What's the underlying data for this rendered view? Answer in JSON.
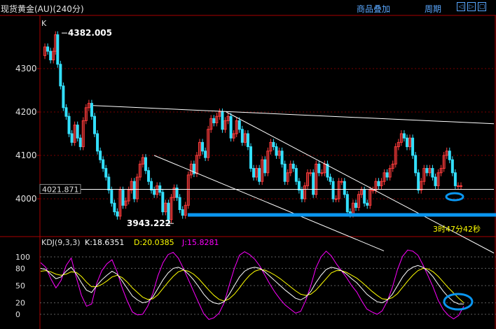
{
  "header": {
    "title": "现货黄金(AU)(240分)",
    "overlay_label": "商品叠加",
    "period_label": "周期",
    "buttons": [
      "◁",
      "▷",
      "▢"
    ]
  },
  "price_panel": {
    "indicator_label": "K",
    "y_ticks": [
      "4300",
      "4200",
      "4100",
      "4000"
    ],
    "current_price_label": "4021.871",
    "high_label": "4382.005",
    "low_label": "3943.222",
    "countdown_label": "3时47分42秒"
  },
  "kdj_panel": {
    "label": "KDJ(9,3,3)",
    "k_label": "K:18.6351",
    "d_label": "D:20.0385",
    "j_label": "J:15.8281",
    "y_ticks": [
      "100",
      "80",
      "50",
      "20",
      "0"
    ]
  },
  "colors": {
    "background": "#000000",
    "up": "#ff3c3c",
    "down": "#33e0ff",
    "grid_price": "#7a0000",
    "grid_kdj": "#606060",
    "k_line": "#ffffff",
    "d_line": "#ffff00",
    "j_line": "#ff00ff",
    "highlight": "#0a96f0"
  },
  "chart_data": {
    "type": "candlestick",
    "ylim": [
      3920,
      4460
    ],
    "y_ticks": [
      4300,
      4200,
      4100,
      4000
    ],
    "high": 4382.005,
    "low": 3943.222,
    "current": 4021.871,
    "path": [
      [
        0,
        4330
      ],
      [
        4,
        4350
      ],
      [
        8,
        4340
      ],
      [
        12,
        4320
      ],
      [
        16,
        4340
      ],
      [
        19,
        4378
      ],
      [
        22,
        4310
      ],
      [
        26,
        4260
      ],
      [
        30,
        4210
      ],
      [
        34,
        4190
      ],
      [
        38,
        4150
      ],
      [
        42,
        4130
      ],
      [
        46,
        4170
      ],
      [
        50,
        4140
      ],
      [
        54,
        4120
      ],
      [
        58,
        4180
      ],
      [
        62,
        4210
      ],
      [
        66,
        4220
      ],
      [
        70,
        4190
      ],
      [
        74,
        4150
      ],
      [
        78,
        4110
      ],
      [
        82,
        4090
      ],
      [
        86,
        4070
      ],
      [
        90,
        4050
      ],
      [
        94,
        4020
      ],
      [
        98,
        3990
      ],
      [
        102,
        3970
      ],
      [
        106,
        3960
      ],
      [
        110,
        4020
      ],
      [
        114,
        3985
      ],
      [
        118,
        3995
      ],
      [
        122,
        4020
      ],
      [
        126,
        4040
      ],
      [
        130,
        4000
      ],
      [
        134,
        4050
      ],
      [
        138,
        4080
      ],
      [
        142,
        4095
      ],
      [
        146,
        4065
      ],
      [
        150,
        4040
      ],
      [
        154,
        4020
      ],
      [
        158,
        4010
      ],
      [
        162,
        4030
      ],
      [
        166,
        4015
      ],
      [
        170,
        3970
      ],
      [
        174,
        3990
      ],
      [
        178,
        3952
      ],
      [
        182,
        4003
      ],
      [
        186,
        4025
      ],
      [
        190,
        4003
      ],
      [
        194,
        3975
      ],
      [
        198,
        3962
      ],
      [
        202,
        3985
      ],
      [
        206,
        4055
      ],
      [
        210,
        4080
      ],
      [
        214,
        4058
      ],
      [
        218,
        4100
      ],
      [
        222,
        4130
      ],
      [
        226,
        4110
      ],
      [
        230,
        4095
      ],
      [
        234,
        4160
      ],
      [
        238,
        4185
      ],
      [
        242,
        4175
      ],
      [
        246,
        4190
      ],
      [
        250,
        4200
      ],
      [
        254,
        4160
      ],
      [
        258,
        4180
      ],
      [
        262,
        4190
      ],
      [
        266,
        4140
      ],
      [
        270,
        4150
      ],
      [
        274,
        4180
      ],
      [
        278,
        4160
      ],
      [
        282,
        4130
      ],
      [
        286,
        4150
      ],
      [
        290,
        4120
      ],
      [
        294,
        4070
      ],
      [
        298,
        4050
      ],
      [
        302,
        4070
      ],
      [
        306,
        4040
      ],
      [
        310,
        4090
      ],
      [
        314,
        4060
      ],
      [
        318,
        4110
      ],
      [
        322,
        4130
      ],
      [
        326,
        4120
      ],
      [
        330,
        4100
      ],
      [
        334,
        4110
      ],
      [
        338,
        4080
      ],
      [
        342,
        4040
      ],
      [
        346,
        4060
      ],
      [
        350,
        4080
      ],
      [
        354,
        4070
      ],
      [
        358,
        4040
      ],
      [
        362,
        4020
      ],
      [
        366,
        4000
      ],
      [
        370,
        4030
      ],
      [
        374,
        4060
      ],
      [
        378,
        4060
      ],
      [
        382,
        4010
      ],
      [
        386,
        4080
      ],
      [
        390,
        4060
      ],
      [
        394,
        4060
      ],
      [
        398,
        4080
      ],
      [
        402,
        4050
      ],
      [
        406,
        4040
      ],
      [
        410,
        4000
      ],
      [
        414,
        4000
      ],
      [
        418,
        4040
      ],
      [
        422,
        4040
      ],
      [
        426,
        4010
      ],
      [
        430,
        3970
      ],
      [
        434,
        3965
      ],
      [
        438,
        3990
      ],
      [
        442,
        3980
      ],
      [
        446,
        4010
      ],
      [
        450,
        4020
      ],
      [
        454,
        3990
      ],
      [
        458,
        3985
      ],
      [
        462,
        4020
      ],
      [
        466,
        4020
      ],
      [
        470,
        4040
      ],
      [
        474,
        4030
      ],
      [
        478,
        4040
      ],
      [
        482,
        4060
      ],
      [
        486,
        4050
      ],
      [
        490,
        4070
      ],
      [
        494,
        4080
      ],
      [
        498,
        4120
      ],
      [
        502,
        4130
      ],
      [
        506,
        4150
      ],
      [
        510,
        4140
      ],
      [
        514,
        4120
      ],
      [
        518,
        4140
      ],
      [
        522,
        4100
      ],
      [
        526,
        4060
      ],
      [
        530,
        4020
      ],
      [
        534,
        4040
      ],
      [
        538,
        4070
      ],
      [
        542,
        4060
      ],
      [
        546,
        4070
      ],
      [
        550,
        4050
      ],
      [
        554,
        4030
      ],
      [
        558,
        4060
      ],
      [
        562,
        4070
      ],
      [
        566,
        4100
      ],
      [
        570,
        4110
      ],
      [
        574,
        4090
      ],
      [
        578,
        4060
      ],
      [
        582,
        4030
      ],
      [
        586,
        4030
      ],
      [
        590,
        4030
      ]
    ],
    "trendlines": [
      {
        "from": [
          "bar_start",
          4215
        ],
        "to": [
          "right",
          4173
        ]
      },
      {
        "from": [
          "bar_mid",
          4200
        ],
        "to": [
          "far_right",
          3875
        ]
      },
      {
        "from": [
          "bar_early",
          4100
        ],
        "to": [
          "bar_mid2",
          4022
        ]
      },
      {
        "horizontal": 4021.871
      },
      {
        "horizontal_highlight": 3963
      }
    ],
    "kdj": {
      "k": [
        80,
        78,
        70,
        62,
        65,
        75,
        82,
        70,
        55,
        42,
        38,
        50,
        60,
        68,
        75,
        70,
        58,
        45,
        32,
        25,
        20,
        22,
        30,
        45,
        60,
        72,
        80,
        82,
        78,
        70,
        60,
        48,
        35,
        25,
        20,
        18,
        22,
        35,
        50,
        65,
        75,
        80,
        82,
        80,
        74,
        66,
        58,
        50,
        42,
        35,
        28,
        25,
        30,
        40,
        55,
        68,
        78,
        82,
        80,
        76,
        70,
        62,
        55,
        45,
        35,
        28,
        22,
        20,
        25,
        35,
        50,
        65,
        76,
        82,
        85,
        82,
        75,
        65,
        52,
        40,
        30,
        22,
        18,
        18
      ],
      "d": [
        75,
        76,
        74,
        70,
        68,
        70,
        74,
        73,
        66,
        56,
        48,
        48,
        52,
        58,
        65,
        68,
        64,
        56,
        46,
        38,
        30,
        26,
        27,
        34,
        45,
        56,
        66,
        74,
        77,
        75,
        70,
        62,
        52,
        42,
        33,
        26,
        23,
        27,
        35,
        46,
        58,
        68,
        75,
        78,
        77,
        73,
        68,
        62,
        55,
        48,
        41,
        35,
        33,
        35,
        42,
        52,
        62,
        72,
        76,
        76,
        73,
        68,
        63,
        56,
        48,
        40,
        33,
        27,
        26,
        29,
        36,
        47,
        58,
        68,
        76,
        80,
        79,
        74,
        66,
        56,
        46,
        37,
        28,
        20
      ]
    }
  }
}
